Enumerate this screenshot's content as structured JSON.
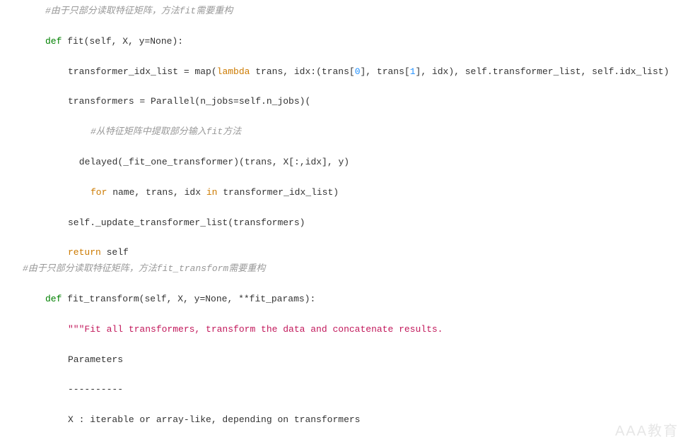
{
  "code": {
    "comment1": "#由于只部分读取特征矩阵，方法fit需要重构",
    "def_kw": "def",
    "fit_name": "fit",
    "fit_params": "(self, X, y=None):",
    "fit_line1_a": "transformer_idx_list = map(",
    "lambda_kw": "lambda",
    "fit_line1_b": " trans, idx:(trans[",
    "zero": "0",
    "fit_line1_c": "], trans[",
    "one": "1",
    "fit_line1_d": "], idx), self.transformer_list, self.idx_list)",
    "fit_line2": "transformers = Parallel(n_jobs=self.n_jobs)(",
    "comment2": "#从特征矩阵中提取部分输入fit方法",
    "fit_line3": " delayed(_fit_one_transformer)(trans, X[:,idx], y)",
    "for_kw": "for",
    "fit_line4_a": " name, trans, idx ",
    "in_kw": "in",
    "fit_line4_b": " transformer_idx_list)",
    "fit_line5": "self._update_transformer_list(transformers)",
    "return_kw": "return",
    "fit_line6": " self",
    "comment3": "#由于只部分读取特征矩阵，方法fit_transform需要重构",
    "ft_name": "fit_transform",
    "ft_params": "(self, X, y=None, **fit_params):",
    "docstring1": "\"\"\"Fit all transformers, transform the data and concatenate results.",
    "docstring2": "Parameters",
    "docstring3": "----------",
    "docstring4": "X : iterable or array-like, depending on transformers"
  },
  "watermark": "AAA教育"
}
